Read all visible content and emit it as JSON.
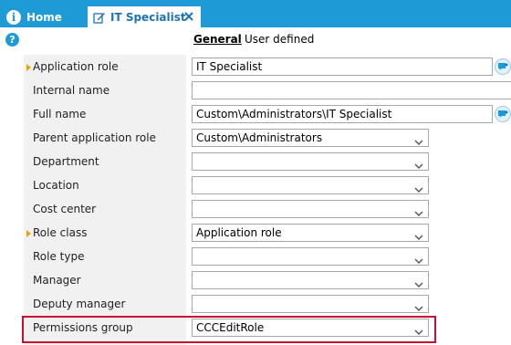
{
  "tabs": [
    {
      "label": "Home",
      "icon": "info-icon"
    },
    {
      "label": "IT Specialist",
      "icon": "edit-icon",
      "active": true
    }
  ],
  "subtabs": [
    {
      "label": "General",
      "active": true
    },
    {
      "label": "User defined"
    }
  ],
  "fields": [
    {
      "label": "Application role",
      "value": "IT Specialist",
      "kind": "text",
      "required": true
    },
    {
      "label": "Internal name",
      "value": "",
      "kind": "text"
    },
    {
      "label": "Full name",
      "value": "Custom\\Administrators\\IT Specialist",
      "kind": "text"
    },
    {
      "label": "Parent application role",
      "value": "Custom\\Administrators",
      "kind": "select"
    },
    {
      "label": "Department",
      "value": "",
      "kind": "select"
    },
    {
      "label": "Location",
      "value": "",
      "kind": "select"
    },
    {
      "label": "Cost center",
      "value": "",
      "kind": "select"
    },
    {
      "label": "Role class",
      "value": "Application role",
      "kind": "select",
      "required": true
    },
    {
      "label": "Role type",
      "value": "",
      "kind": "select"
    },
    {
      "label": "Manager",
      "value": "",
      "kind": "select"
    },
    {
      "label": "Deputy manager",
      "value": "",
      "kind": "select"
    },
    {
      "label": "Permissions group",
      "value": "CCCEditRole",
      "kind": "select"
    }
  ],
  "colors": {
    "tabbar": "#1e9bd7",
    "active_tab_text": "#1e73b8",
    "required_marker": "#e7a500",
    "highlight": "#c8102e",
    "label_column": "#f1f1f1"
  }
}
